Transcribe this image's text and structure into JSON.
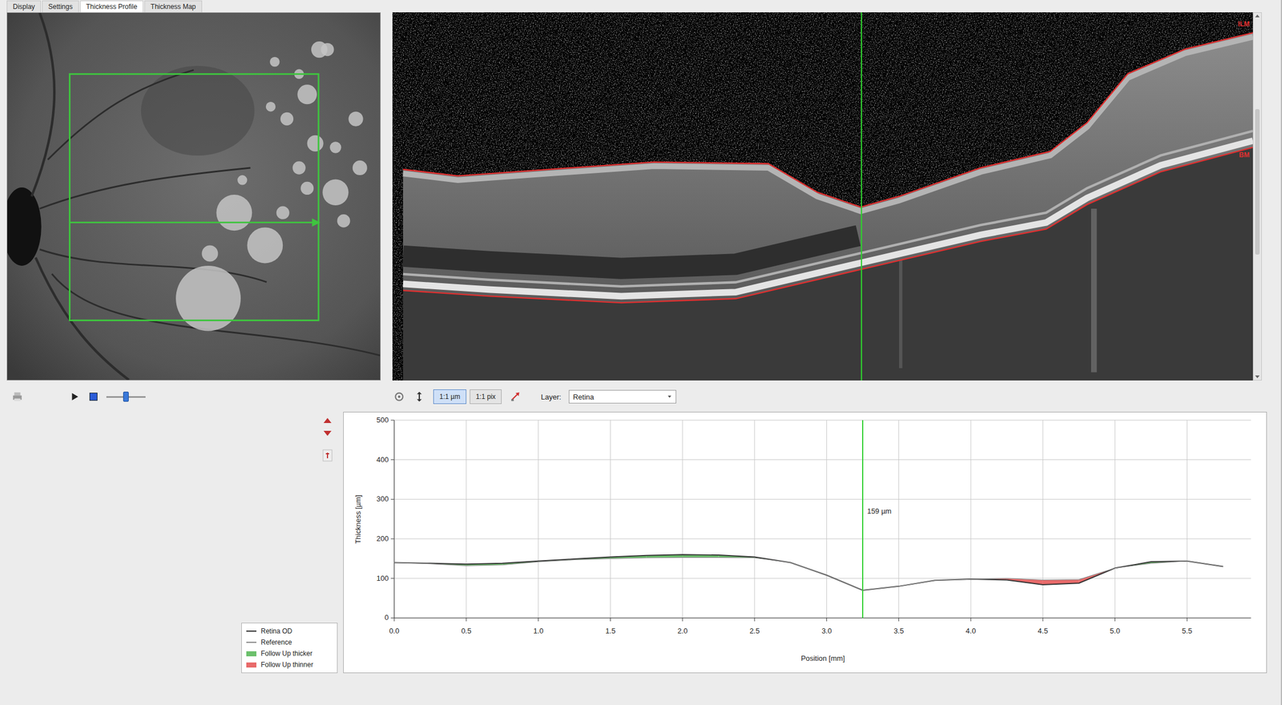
{
  "tabs": [
    {
      "label": "Display",
      "selected": false
    },
    {
      "label": "Settings",
      "selected": false
    },
    {
      "label": "Thickness Profile",
      "selected": true
    },
    {
      "label": "Thickness Map",
      "selected": false
    }
  ],
  "bscan": {
    "labels": [
      {
        "text": "ILM"
      },
      {
        "text": "BM"
      }
    ]
  },
  "playback": {
    "slider": {
      "level": 0.5
    }
  },
  "scale_buttons": [
    {
      "label": "1:1 µm",
      "selected": true
    },
    {
      "label": "1:1 pix",
      "selected": false
    }
  ],
  "layer": {
    "label": "Layer:",
    "value": "Retina"
  },
  "chart": {
    "y_axis": {
      "title": "Thickness [µm]",
      "ticks": [
        "500",
        "400",
        "300",
        "200",
        "100",
        "0"
      ]
    },
    "x_axis": {
      "title": "Position [mm]",
      "ticks": [
        "0.0",
        "0.5",
        "1.0",
        "1.5",
        "2.0",
        "2.5",
        "3.0",
        "3.5",
        "4.0",
        "4.5",
        "5.0",
        "5.5"
      ]
    },
    "positions": [
      0,
      0.25,
      0.5,
      0.75,
      1.0,
      1.25,
      1.5,
      1.75,
      2.0,
      2.25,
      2.5,
      2.75,
      3.0,
      3.25,
      3.5,
      3.75,
      4.0,
      4.25,
      4.5,
      4.75,
      5.0,
      5.25,
      5.5,
      5.75
    ],
    "series": [
      {
        "values": [
          140,
          138,
          136,
          138,
          144,
          149,
          154,
          158,
          160,
          159,
          154,
          140,
          108,
          70,
          80,
          95,
          98,
          96,
          84,
          88,
          126,
          142,
          144,
          130
        ],
        "color": "#333333"
      },
      {
        "values": [
          140,
          137,
          132,
          134,
          142,
          147,
          150,
          152,
          153,
          153,
          152,
          140,
          108,
          70,
          80,
          95,
          98,
          100,
          96,
          97,
          126,
          138,
          144,
          130
        ],
        "color": "#8a8a8a"
      }
    ],
    "cursor": {
      "position": 3.25,
      "label": "159 µm"
    },
    "legend": [
      {
        "label": "Retina OD",
        "kind": "line",
        "color": "#333333"
      },
      {
        "label": "Reference",
        "kind": "line",
        "color": "#8a8a8a"
      },
      {
        "label": "Follow Up thicker",
        "kind": "fill",
        "color": "#6cc06c"
      },
      {
        "label": "Follow Up thinner",
        "kind": "fill",
        "color": "#e86a6a"
      }
    ]
  }
}
